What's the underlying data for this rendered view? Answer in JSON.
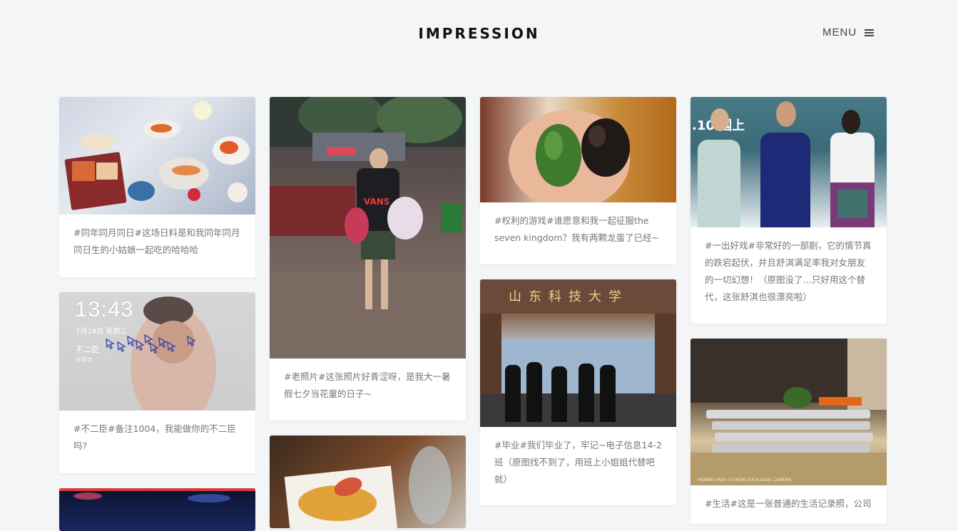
{
  "header": {
    "brand": "IMPRESSION",
    "menu_label": "MENU"
  },
  "cards": [
    {
      "caption": "#同年同月同日#这场日料是和我同年同月同日生的小姑娘一起吃的哈哈哈"
    },
    {
      "caption": "#老照片#这张照片好青涩呀，是我大一暑假七夕当花童的日子~"
    },
    {
      "caption": "#权利的游戏#谁愿意和我一起征服the seven kingdom？我有两颗龙蛋了已经~"
    },
    {
      "caption": "#一出好戏#非常好的一部剧，它的情节真的跌宕起伏，并且舒淇满足率我对女朋友的一切幻想！（原图没了…只好用这个替代，这张舒淇也很漂亮啦）"
    },
    {
      "caption": "#不二臣#备注1004，我能做你的不二臣吗?"
    },
    {
      "caption": "#毕业#我们毕业了，牢记~电子信息14-2班（原图找不到了，用班上小姐姐代替吧就）"
    },
    {
      "caption": "#生活#这是一张普通的生活记录照，公司"
    }
  ],
  "photo_text": {
    "lock_time": "13:43",
    "lock_date": "7月18日 星期三",
    "lock_title": "不二臣",
    "lock_artist": "徐秉龙",
    "gate_sign": "山东科技大学",
    "camera_mark": "HUAWEI Mate 10\nNEW LEICA DUAL CAMERA",
    "shirt_text": "VANS",
    "movie_text": ".10 国上"
  },
  "colors": {
    "background": "#f4f5f7",
    "card": "#ffffff",
    "caption": "#777777",
    "brand": "#111111"
  }
}
